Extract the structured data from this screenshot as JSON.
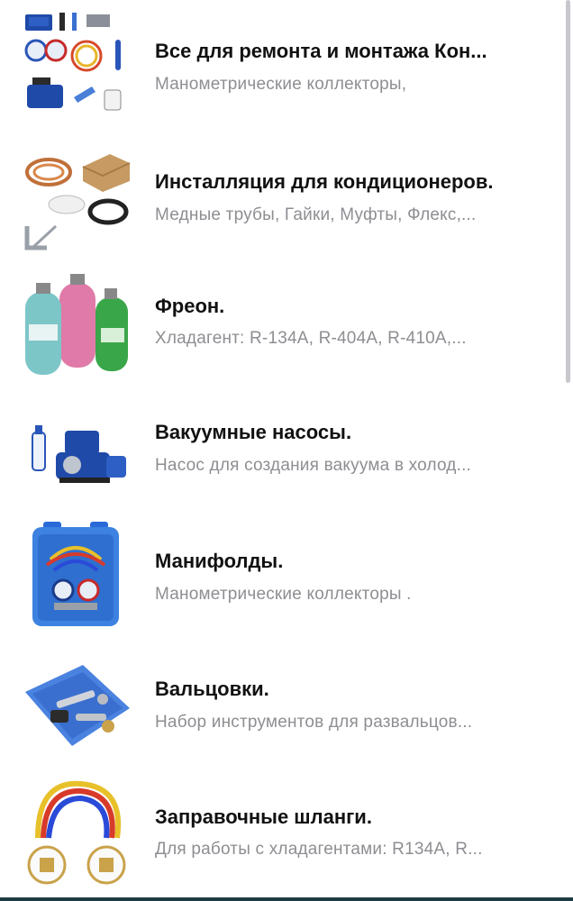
{
  "items": [
    {
      "title": "Все для ремонта и монтажа Кон...",
      "subtitle": "Манометрические коллекторы,",
      "icon": "ac-repair-tools-icon"
    },
    {
      "title": "Инсталляция для кондиционеров.",
      "subtitle": "Медные трубы, Гайки, Муфты, Флекс,...",
      "icon": "installation-materials-icon"
    },
    {
      "title": "Фреон.",
      "subtitle": "Хладагент: R-134A, R-404A, R-410A,...",
      "icon": "freon-cylinders-icon"
    },
    {
      "title": "Вакуумные насосы.",
      "subtitle": "Насос для создания вакуума в холод...",
      "icon": "vacuum-pump-icon"
    },
    {
      "title": "Манифолды.",
      "subtitle": "Манометрические коллекторы .",
      "icon": "manifold-case-icon"
    },
    {
      "title": "Вальцовки.",
      "subtitle": "Набор инструментов для развальцов...",
      "icon": "flaring-tool-kit-icon"
    },
    {
      "title": "Заправочные шланги.",
      "subtitle": "Для работы с хладагентами: R134A, R...",
      "icon": "charging-hoses-icon"
    }
  ]
}
